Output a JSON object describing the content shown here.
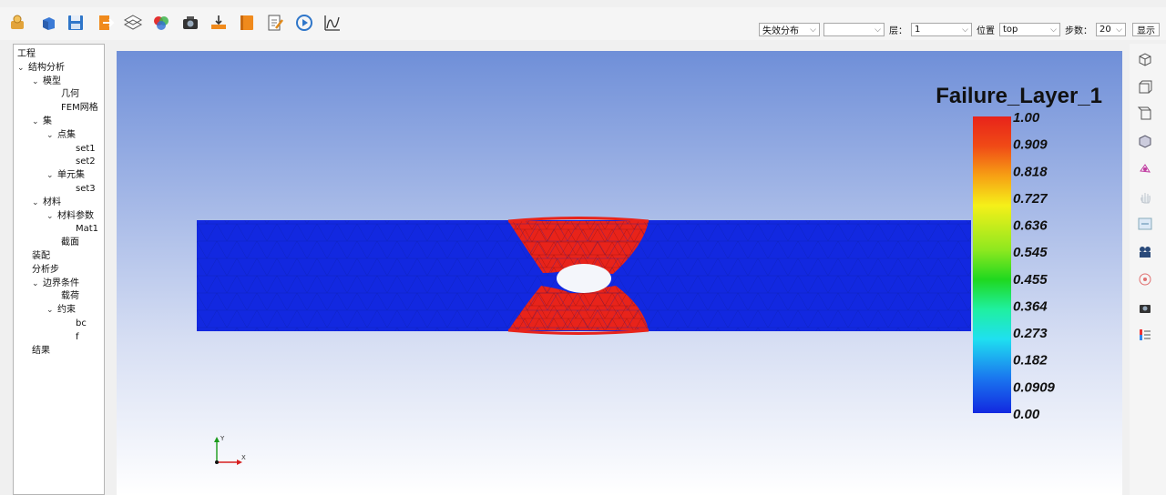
{
  "toolbar": {
    "icons": [
      "open-icon",
      "cube-icon",
      "save-icon",
      "export-icon",
      "layers-icon",
      "material-icon",
      "camera-icon",
      "load-icon",
      "book-icon",
      "edit-icon",
      "play-icon",
      "curve-icon"
    ],
    "failure_select": "失效分布",
    "empty_select": "",
    "layer_label": "层：",
    "layer_value": "1",
    "position_label": "位置",
    "position_value": "top",
    "step_label": "步数：",
    "step_value": "20",
    "display_button": "显示"
  },
  "tree": {
    "items": [
      {
        "label": "工程",
        "level": 0,
        "arrow": false
      },
      {
        "label": "结构分析",
        "level": 0,
        "arrow": true
      },
      {
        "label": "模型",
        "level": 1,
        "arrow": true
      },
      {
        "label": "几何",
        "level": 3,
        "arrow": false
      },
      {
        "label": "FEM网格",
        "level": 3,
        "arrow": false
      },
      {
        "label": "集",
        "level": 1,
        "arrow": true
      },
      {
        "label": "点集",
        "level": 2,
        "arrow": true
      },
      {
        "label": "set1",
        "level": 4,
        "arrow": false
      },
      {
        "label": "set2",
        "level": 4,
        "arrow": false
      },
      {
        "label": "单元集",
        "level": 2,
        "arrow": true
      },
      {
        "label": "set3",
        "level": 4,
        "arrow": false
      },
      {
        "label": "材料",
        "level": 1,
        "arrow": true
      },
      {
        "label": "材料参数",
        "level": 2,
        "arrow": true
      },
      {
        "label": "Mat1",
        "level": 4,
        "arrow": false
      },
      {
        "label": "截面",
        "level": 3,
        "arrow": false
      },
      {
        "label": "装配",
        "level": 1,
        "arrow": false
      },
      {
        "label": "分析步",
        "level": 1,
        "arrow": false
      },
      {
        "label": "边界条件",
        "level": 1,
        "arrow": true
      },
      {
        "label": "载荷",
        "level": 3,
        "arrow": false
      },
      {
        "label": "约束",
        "level": 2,
        "arrow": true
      },
      {
        "label": "bc",
        "level": 4,
        "arrow": false
      },
      {
        "label": "f",
        "level": 4,
        "arrow": false
      },
      {
        "label": "结果",
        "level": 1,
        "arrow": false
      }
    ]
  },
  "viewport": {
    "legend_title": "Failure_Layer_1",
    "legend_ticks": [
      "1.00",
      "0.909",
      "0.818",
      "0.727",
      "0.636",
      "0.545",
      "0.455",
      "0.364",
      "0.273",
      "0.182",
      "0.0909",
      "0.00"
    ],
    "axis_y": "Y",
    "axis_x": "X",
    "colors": {
      "safe": "#1228e0",
      "failed": "#e8231a"
    }
  },
  "sidebar": {
    "icons": [
      "view-iso-icon",
      "view-front-icon",
      "view-top-icon",
      "view-shaded-icon",
      "rotate-icon",
      "pan-icon",
      "fit-icon",
      "camera-icon",
      "record-icon",
      "screenshot-icon",
      "legend-icon"
    ]
  }
}
